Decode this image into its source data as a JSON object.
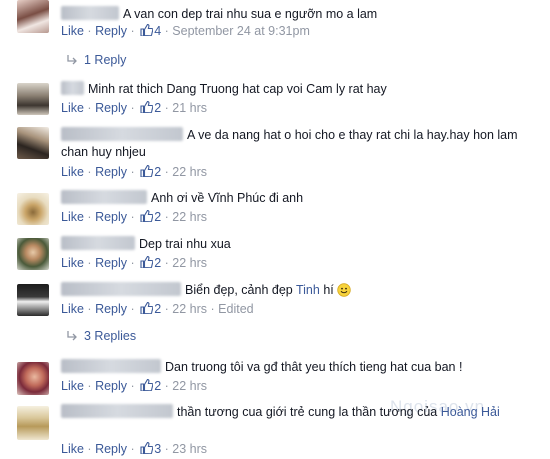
{
  "labels": {
    "like": "Like",
    "reply": "Reply",
    "sep": "·"
  },
  "comments": [
    {
      "text": "A van con dep trai nhu sua e ngưỡn mo a lam",
      "likes": "4",
      "time": "September 24 at 9:31pm"
    },
    {
      "text": "Minh rat thich Dang Truong hat cap voi Cam ly rat hay",
      "likes": "2",
      "time": "21 hrs"
    },
    {
      "text": "A ve da nang hat o hoi cho e thay rat chi la hay.hay hon lam chan huy nhjeu",
      "likes": "2",
      "time": "22 hrs"
    },
    {
      "text": "Anh ơi về Vĩnh Phúc đi anh",
      "likes": "2",
      "time": "22 hrs"
    },
    {
      "text": "Dep trai nhu xua",
      "likes": "2",
      "time": "22 hrs"
    },
    {
      "text": "Biển đẹp, cảnh đẹp",
      "tag": "Tinh",
      "text_after": "hí",
      "likes": "2",
      "time": "22 hrs",
      "edited": "Edited"
    },
    {
      "text": "Dan truong tôi va gđ thât yeu thích tieng hat cua ban !",
      "likes": "2",
      "time": "22 hrs"
    },
    {
      "text": "thần tương cua giới trẻ cung la thần tương của",
      "tag": "Hoàng Hải",
      "likes": "3",
      "time": "23 hrs"
    }
  ],
  "replies_links": [
    "1 Reply",
    "3 Replies"
  ],
  "watermark": "Ngoisao.vn",
  "icons": {
    "like": "thumbs-up-icon",
    "reply": "reply-arrow-icon",
    "smile": "smiley-emoji-icon"
  },
  "colors": {
    "link": "#3b5998",
    "meta": "#9197a3",
    "text": "#141823"
  }
}
